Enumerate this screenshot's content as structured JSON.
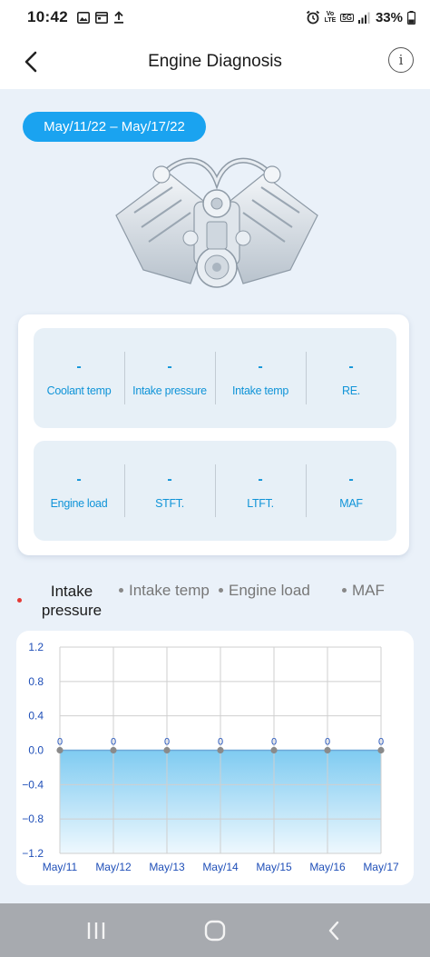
{
  "status_bar": {
    "time": "10:42",
    "battery": "33%",
    "network_vo": "Vo",
    "network_lte": "LTE",
    "network_5g": "5G"
  },
  "header": {
    "title": "Engine Diagnosis"
  },
  "date_range": "May/11/22 – May/17/22",
  "metrics": {
    "row1": [
      {
        "value": "-",
        "label": "Coolant temp"
      },
      {
        "value": "-",
        "label": "Intake pressure"
      },
      {
        "value": "-",
        "label": "Intake temp"
      },
      {
        "value": "-",
        "label": "RE."
      }
    ],
    "row2": [
      {
        "value": "-",
        "label": "Engine load"
      },
      {
        "value": "-",
        "label": "STFT."
      },
      {
        "value": "-",
        "label": "LTFT."
      },
      {
        "value": "-",
        "label": "MAF"
      }
    ]
  },
  "legend": {
    "active_line1": "Intake",
    "active_line2": "pressure",
    "items": [
      "Intake temp",
      "Engine load",
      "MAF"
    ],
    "active_color": "#e53935",
    "inactive_color": "#8a8a8a"
  },
  "chart_data": {
    "type": "area",
    "categories": [
      "May/11",
      "May/12",
      "May/13",
      "May/14",
      "May/15",
      "May/16",
      "May/17"
    ],
    "values": [
      0,
      0,
      0,
      0,
      0,
      0,
      0
    ],
    "data_labels": [
      "0",
      "0",
      "0",
      "0",
      "0",
      "0",
      "0"
    ],
    "y_ticks": [
      "1.2",
      "0.8",
      "0.4",
      "0.0",
      "−0.4",
      "−0.8",
      "−1.2"
    ],
    "ylim": [
      -1.2,
      1.2
    ],
    "grid": true,
    "fill_color": "#7fcbf1",
    "line_color": "#6fa8d8",
    "axis_label_color": "#1f4fb8"
  },
  "icons": {
    "back": "chevron-left-icon",
    "info": "info-icon",
    "nav_recents": "recents-icon",
    "nav_home": "home-icon",
    "nav_back": "back-icon"
  },
  "info_glyph": "i"
}
